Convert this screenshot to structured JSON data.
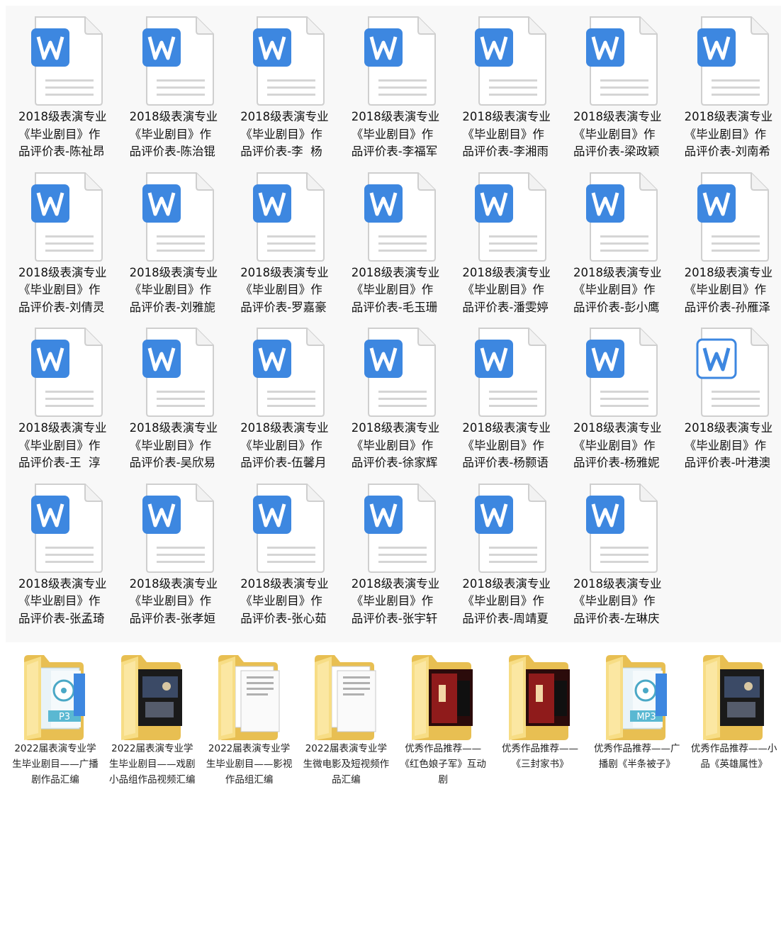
{
  "documents": [
    {
      "line1": "2018级表演专业",
      "line2": "《毕业剧目》作",
      "line3": "品评价表-陈祉昂"
    },
    {
      "line1": "2018级表演专业",
      "line2": "《毕业剧目》作",
      "line3": "品评价表-陈治锟"
    },
    {
      "line1": "2018级表演专业",
      "line2": "《毕业剧目》作",
      "line3": "品评价表-李  杨"
    },
    {
      "line1": "2018级表演专业",
      "line2": "《毕业剧目》作",
      "line3": "品评价表-李福军"
    },
    {
      "line1": "2018级表演专业",
      "line2": "《毕业剧目》作",
      "line3": "品评价表-李湘雨"
    },
    {
      "line1": "2018级表演专业",
      "line2": "《毕业剧目》作",
      "line3": "品评价表-梁政颖"
    },
    {
      "line1": "2018级表演专业",
      "line2": "《毕业剧目》作",
      "line3": "品评价表-刘南希"
    },
    {
      "line1": "2018级表演专业",
      "line2": "《毕业剧目》作",
      "line3": "品评价表-刘倩灵"
    },
    {
      "line1": "2018级表演专业",
      "line2": "《毕业剧目》作",
      "line3": "品评价表-刘雅旎"
    },
    {
      "line1": "2018级表演专业",
      "line2": "《毕业剧目》作",
      "line3": "品评价表-罗嘉豪"
    },
    {
      "line1": "2018级表演专业",
      "line2": "《毕业剧目》作",
      "line3": "品评价表-毛玉珊"
    },
    {
      "line1": "2018级表演专业",
      "line2": "《毕业剧目》作",
      "line3": "品评价表-潘雯婷"
    },
    {
      "line1": "2018级表演专业",
      "line2": "《毕业剧目》作",
      "line3": "品评价表-彭小鹰"
    },
    {
      "line1": "2018级表演专业",
      "line2": "《毕业剧目》作",
      "line3": "品评价表-孙雁泽"
    },
    {
      "line1": "2018级表演专业",
      "line2": "《毕业剧目》作",
      "line3": "品评价表-王  淳"
    },
    {
      "line1": "2018级表演专业",
      "line2": "《毕业剧目》作",
      "line3": "品评价表-吴欣易"
    },
    {
      "line1": "2018级表演专业",
      "line2": "《毕业剧目》作",
      "line3": "品评价表-伍馨月"
    },
    {
      "line1": "2018级表演专业",
      "line2": "《毕业剧目》作",
      "line3": "品评价表-徐家辉"
    },
    {
      "line1": "2018级表演专业",
      "line2": "《毕业剧目》作",
      "line3": "品评价表-杨颢语"
    },
    {
      "line1": "2018级表演专业",
      "line2": "《毕业剧目》作",
      "line3": "品评价表-杨雅妮"
    },
    {
      "line1": "2018级表演专业",
      "line2": "《毕业剧目》作",
      "line3": "品评价表-叶港澳",
      "icon_style": "outline"
    },
    {
      "line1": "2018级表演专业",
      "line2": "《毕业剧目》作",
      "line3": "品评价表-张孟琦"
    },
    {
      "line1": "2018级表演专业",
      "line2": "《毕业剧目》作",
      "line3": "品评价表-张孝姮"
    },
    {
      "line1": "2018级表演专业",
      "line2": "《毕业剧目》作",
      "line3": "品评价表-张心茹"
    },
    {
      "line1": "2018级表演专业",
      "line2": "《毕业剧目》作",
      "line3": "品评价表-张宇轩"
    },
    {
      "line1": "2018级表演专业",
      "line2": "《毕业剧目》作",
      "line3": "品评价表-周靖夏"
    },
    {
      "line1": "2018级表演专业",
      "line2": "《毕业剧目》作",
      "line3": "品评价表-左琳庆"
    }
  ],
  "folders": [
    {
      "label": "2022届表演专业学生毕业剧目——广播剧作品汇编",
      "icon": "folder-mp3-icon",
      "preview_text": "P3"
    },
    {
      "label": "2022届表演专业学生毕业剧目——戏剧小品组作品视频汇编",
      "icon": "folder-video-icon"
    },
    {
      "label": "2022届表演专业学生毕业剧目——影视作品组汇编",
      "icon": "folder-documents-icon"
    },
    {
      "label": "2022届表演专业学生微电影及短视频作品汇编",
      "icon": "folder-documents-icon"
    },
    {
      "label": "优秀作品推荐——《红色娘子军》互动剧",
      "icon": "folder-poster-icon"
    },
    {
      "label": "优秀作品推荐——《三封家书》",
      "icon": "folder-poster-icon"
    },
    {
      "label": "优秀作品推荐——广播剧《半条被子》",
      "icon": "folder-mp3-icon",
      "preview_text": "MP3"
    },
    {
      "label": "优秀作品推荐——小品《英雄属性》",
      "icon": "folder-video-icon"
    }
  ],
  "colors": {
    "word_blue": "#3d87e0",
    "folder_yellow": "#f5d66e"
  }
}
